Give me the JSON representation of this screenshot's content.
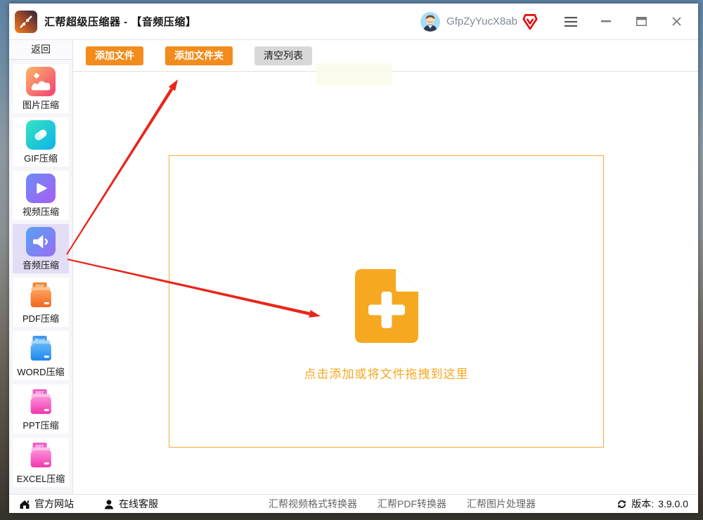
{
  "window": {
    "title": "汇帮超级压缩器 - 【音频压缩】",
    "user": {
      "name": "GfpZyYucX8ab",
      "badge_icon": "vip-diamond-icon"
    },
    "controls": [
      "menu-icon",
      "minimize-icon",
      "maximize-icon",
      "close-icon"
    ]
  },
  "sidebar": {
    "back_label": "返回",
    "items": [
      {
        "label": "图片压缩",
        "icon": "image-compress-icon",
        "selected": false
      },
      {
        "label": "GIF压缩",
        "icon": "gif-compress-icon",
        "selected": false
      },
      {
        "label": "视频压缩",
        "icon": "video-compress-icon",
        "selected": false
      },
      {
        "label": "音频压缩",
        "icon": "audio-compress-icon",
        "selected": true
      },
      {
        "label": "PDF压缩",
        "icon": "pdf-folder-icon",
        "tag": "PDF",
        "selected": false
      },
      {
        "label": "WORD压缩",
        "icon": "word-folder-icon",
        "tag": "Word",
        "selected": false
      },
      {
        "label": "PPT压缩",
        "icon": "ppt-folder-icon",
        "tag": "PPT",
        "selected": false
      },
      {
        "label": "EXCEL压缩",
        "icon": "excel-folder-icon",
        "tag": "PPT",
        "selected": false
      }
    ]
  },
  "toolbar": {
    "add_file_label": "添加文件",
    "add_folder_label": "添加文件夹",
    "clear_list_label": "清空列表"
  },
  "dropzone": {
    "hint": "点击添加或将文件拖拽到这里",
    "icon": "document-plus-icon"
  },
  "footer": {
    "official_site": "官方网站",
    "online_support": "在线客服",
    "links": [
      "汇帮视频格式转换器",
      "汇帮PDF转换器",
      "汇帮图片处理器"
    ],
    "version_label": "版本:",
    "version": "3.9.0.0"
  },
  "colors": {
    "accent_orange": "#f28c1d",
    "dropzone_orange": "#f6a821",
    "annotation_red": "#e8261a",
    "selected_item_bg": "#e4ddf6",
    "vip_red": "#e50d0d"
  }
}
